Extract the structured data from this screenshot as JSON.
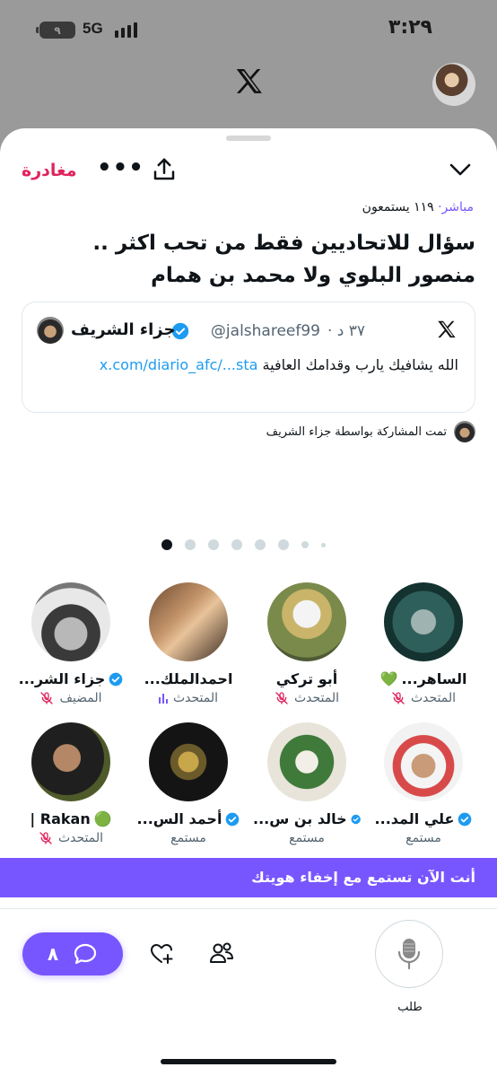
{
  "status_bar": {
    "time": "٣:٢٩",
    "network": "5G",
    "battery_level": "٩"
  },
  "header": {
    "leave_label": "مغادرة"
  },
  "space": {
    "live_label": "مباشر",
    "listeners_text": "١١٩ يستمعون",
    "title": "سؤال للاتحاديين فقط من تحب اكثر .. منصور البلوي ولا محمد بن همام"
  },
  "pinned_tweet": {
    "author_name": "جزاء الشريف",
    "handle": "@jalshareef99",
    "time": "٣٧ د",
    "text": "الله يشافيك يارب وقدامك العافية",
    "link": "x.com/diario_afc/...sta"
  },
  "shared_by_text": "تمت المشاركة بواسطة جزاء الشريف",
  "speakers": [
    {
      "name": "جزاء الشر...",
      "role": "المضيف",
      "verified": true,
      "mic": "muted"
    },
    {
      "name": "احمدالملك...",
      "role": "المتحدث",
      "verified": false,
      "mic": "speaking"
    },
    {
      "name": "أبو تركي",
      "role": "المتحدث",
      "verified": false,
      "mic": "muted"
    },
    {
      "name": "الساهر...",
      "role": "المتحدث",
      "verified": false,
      "mic": "muted",
      "emoji": "💚"
    },
    {
      "name": "Rakan |",
      "role": "المتحدث",
      "verified": false,
      "mic": "muted",
      "emoji": "🟢"
    },
    {
      "name": "أحمد الس...",
      "role": "مستمع",
      "verified": true,
      "mic": "none"
    },
    {
      "name": "خالد بن س...",
      "role": "مستمع",
      "verified": true,
      "mic": "none"
    },
    {
      "name": "علي المد...",
      "role": "مستمع",
      "verified": true,
      "mic": "none"
    }
  ],
  "anon_banner": "أنت الآن تستمع مع إخفاء هويتك",
  "bottom_bar": {
    "comment_count": "٨",
    "request_label": "طلب"
  },
  "colors": {
    "accent": "#7856ff",
    "leave": "#e0245e",
    "verified": "#1d9bf0",
    "link": "#1d9bf0"
  },
  "icons": [
    "x-logo-icon",
    "share-icon",
    "more-icon",
    "chevron-down-icon",
    "verified-icon",
    "mic-off-icon",
    "comment-icon",
    "heart-plus-icon",
    "people-icon",
    "microphone-icon"
  ]
}
